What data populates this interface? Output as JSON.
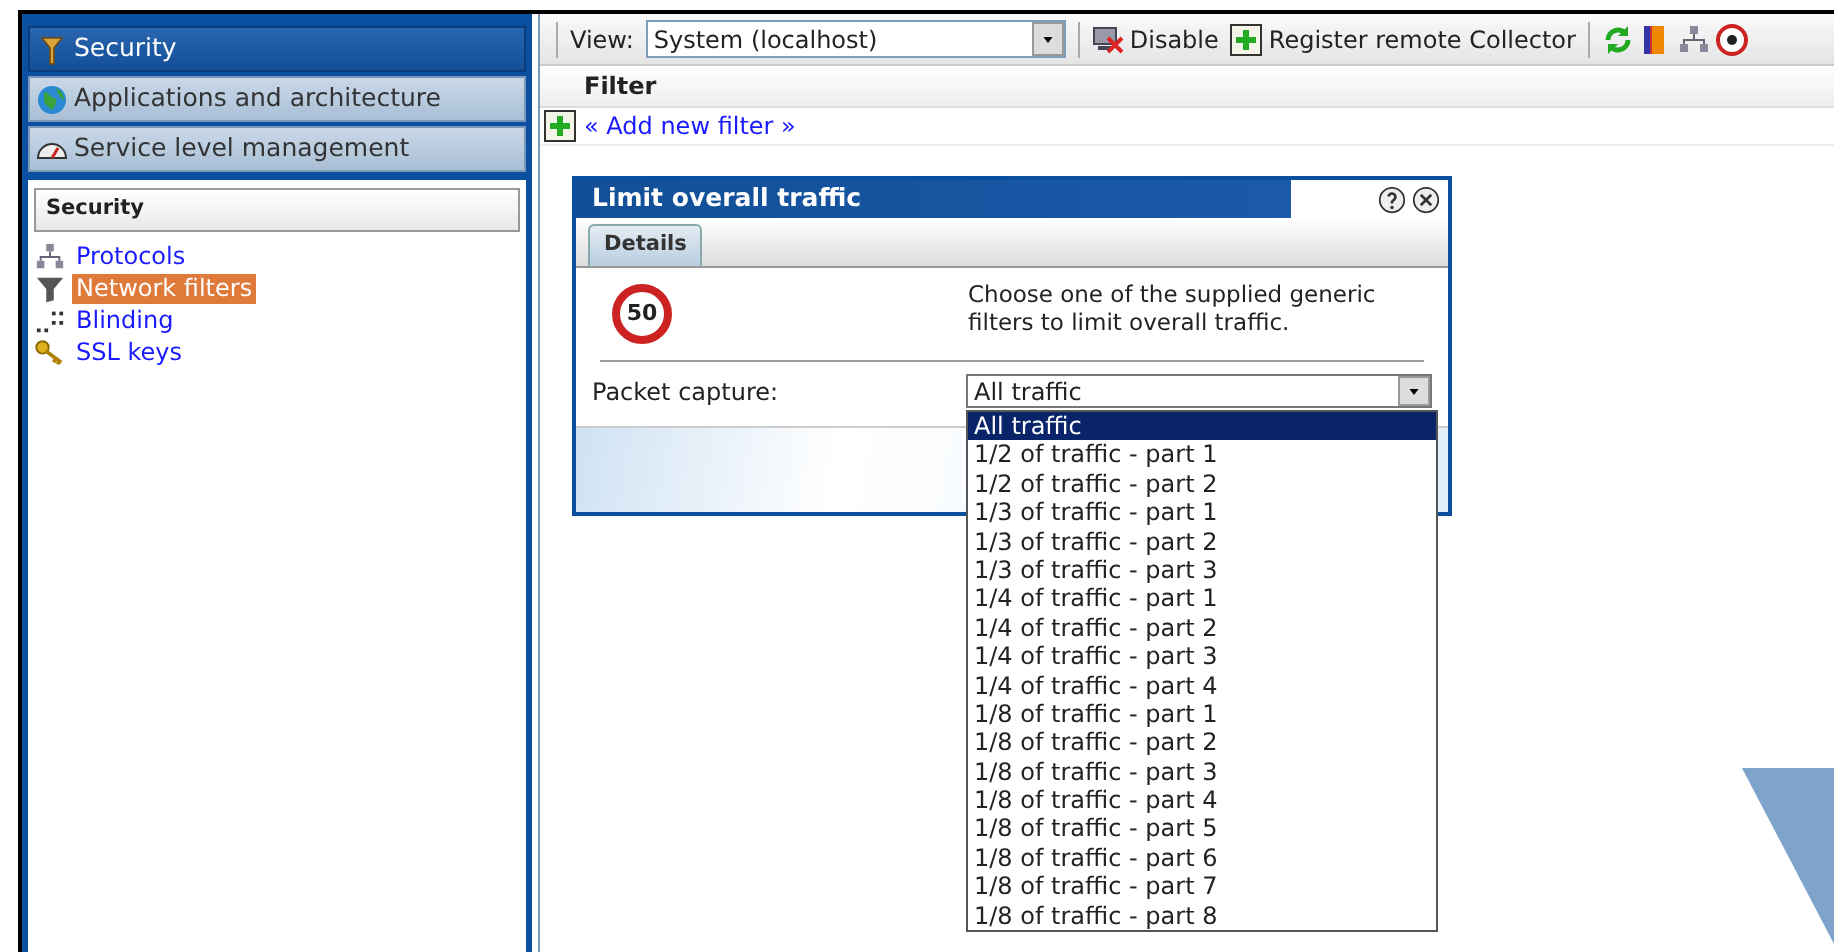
{
  "nav_tabs": [
    {
      "label": "Security",
      "selected": true
    },
    {
      "label": "Applications and architecture",
      "selected": false
    },
    {
      "label": "Service level management",
      "selected": false
    }
  ],
  "tree": {
    "heading": "Security",
    "items": [
      {
        "label": "Protocols",
        "selected": false
      },
      {
        "label": "Network filters",
        "selected": true
      },
      {
        "label": "Blinding",
        "selected": false
      },
      {
        "label": "SSL keys",
        "selected": false
      }
    ]
  },
  "toolbar": {
    "view_label": "View:",
    "view_value": "System (localhost)",
    "buttons": [
      {
        "label": "Disable"
      },
      {
        "label": "Register remote Collector"
      }
    ]
  },
  "filter_table": {
    "column": "Filter",
    "add_link": "« Add new filter »"
  },
  "dialog": {
    "title": "Limit overall traffic",
    "tabs": [
      {
        "label": "Details",
        "selected": true
      }
    ],
    "description": "Choose one of the supplied generic filters to limit overall traffic.",
    "sign_text": "50",
    "field_label": "Packet capture:",
    "field_value": "All traffic",
    "options": [
      {
        "label": "All traffic",
        "selected": true
      },
      {
        "label": "1/2 of traffic - part 1",
        "selected": false
      },
      {
        "label": "1/2 of traffic - part 2",
        "selected": false
      },
      {
        "label": "1/3 of traffic - part 1",
        "selected": false
      },
      {
        "label": "1/3 of traffic - part 2",
        "selected": false
      },
      {
        "label": "1/3 of traffic - part 3",
        "selected": false
      },
      {
        "label": "1/4 of traffic - part 1",
        "selected": false
      },
      {
        "label": "1/4 of traffic - part 2",
        "selected": false
      },
      {
        "label": "1/4 of traffic - part 3",
        "selected": false
      },
      {
        "label": "1/4 of traffic - part 4",
        "selected": false
      },
      {
        "label": "1/8 of traffic - part 1",
        "selected": false
      },
      {
        "label": "1/8 of traffic - part 2",
        "selected": false
      },
      {
        "label": "1/8 of traffic - part 3",
        "selected": false
      },
      {
        "label": "1/8 of traffic - part 4",
        "selected": false
      },
      {
        "label": "1/8 of traffic - part 5",
        "selected": false
      },
      {
        "label": "1/8 of traffic - part 6",
        "selected": false
      },
      {
        "label": "1/8 of traffic - part 7",
        "selected": false
      },
      {
        "label": "1/8 of traffic - part 8",
        "selected": false
      }
    ]
  }
}
